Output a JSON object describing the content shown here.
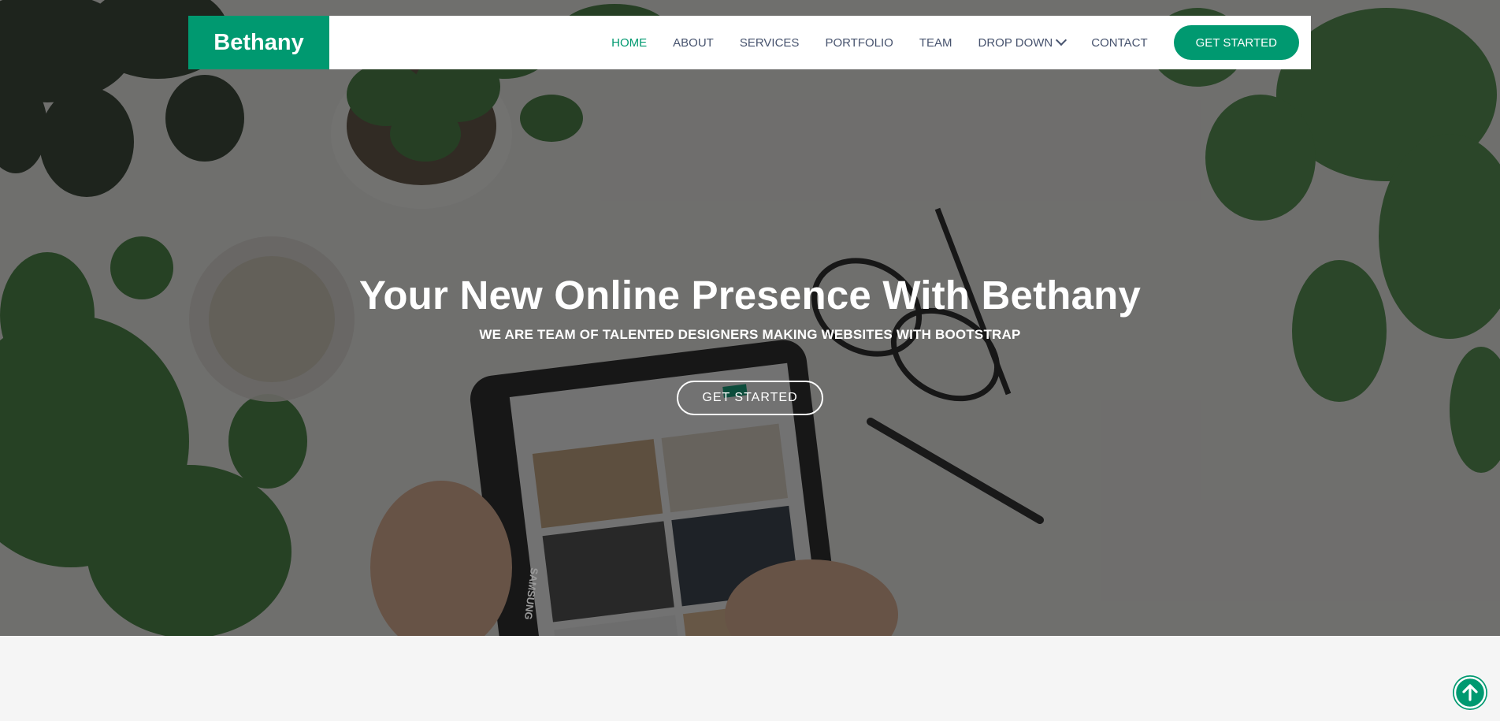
{
  "brand": {
    "name": "Bethany",
    "accent_color": "#009970"
  },
  "nav": {
    "items": [
      {
        "label": "HOME",
        "active": true
      },
      {
        "label": "ABOUT",
        "active": false
      },
      {
        "label": "SERVICES",
        "active": false
      },
      {
        "label": "PORTFOLIO",
        "active": false
      },
      {
        "label": "TEAM",
        "active": false
      },
      {
        "label": "DROP DOWN",
        "active": false,
        "has_dropdown": true
      },
      {
        "label": "CONTACT",
        "active": false
      }
    ],
    "cta_label": "GET STARTED"
  },
  "hero": {
    "title": "Your New Online Presence With Bethany",
    "subtitle": "WE ARE TEAM OF TALENTED DESIGNERS MAKING WEBSITES WITH BOOTSTRAP",
    "button_label": "GET STARTED",
    "tablet_brand": "SAMSUNG"
  },
  "back_to_top": {
    "icon": "arrow-up-circle-icon"
  }
}
